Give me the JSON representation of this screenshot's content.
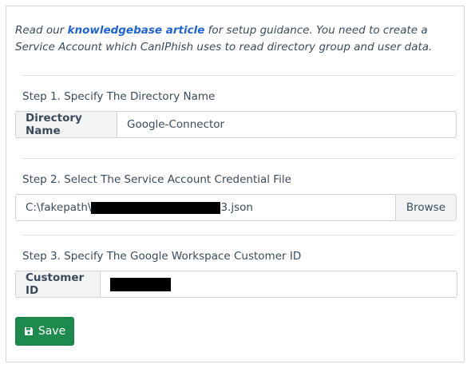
{
  "intro": {
    "prefix": "Read our ",
    "link": "knowledgebase article",
    "suffix": " for setup guidance. You need to create a Service Account which CanIPhish uses to read directory group and user data."
  },
  "step1": {
    "heading": "Step 1. Specify The Directory Name",
    "label": "Directory Name",
    "value": "Google-Connector"
  },
  "step2": {
    "heading": "Step 2. Select The Service Account Credential File",
    "path_prefix": "C:\\fakepath\\",
    "path_suffix": "3.json",
    "browse": "Browse"
  },
  "step3": {
    "heading": "Step 3. Specify The Google Workspace Customer ID",
    "label": "Customer ID"
  },
  "save_label": "Save",
  "colors": {
    "link": "#1f63d6",
    "save_button": "#1f8a4d"
  }
}
